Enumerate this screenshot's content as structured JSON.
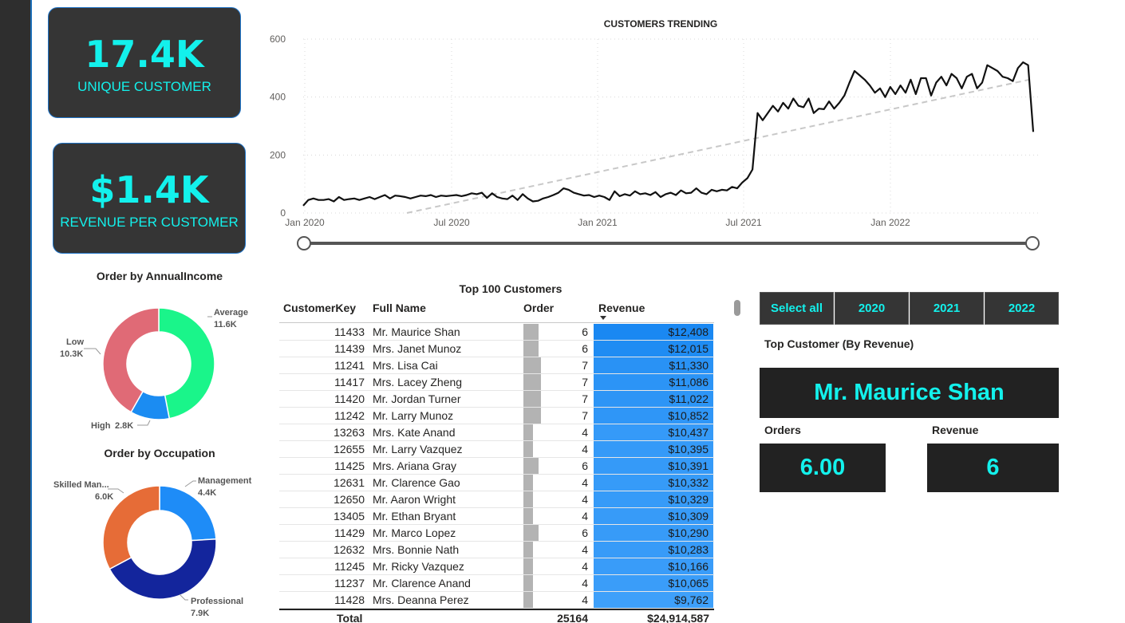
{
  "kpis": {
    "unique_customer": {
      "value": "17.4K",
      "label": "UNIQUE CUSTOMER"
    },
    "revenue_per_customer": {
      "value": "$1.4K",
      "label": "REVENUE PER CUSTOMER"
    }
  },
  "trend": {
    "title": "CUSTOMERS TRENDING",
    "y_ticks": [
      "600",
      "400",
      "200",
      "0"
    ],
    "x_ticks": [
      "Jan 2020",
      "Jul 2020",
      "Jan 2021",
      "Jul 2021",
      "Jan 2022"
    ]
  },
  "annual_income": {
    "title": "Order by AnnualIncome",
    "segments": [
      {
        "name": "Average",
        "value": "11.6K",
        "color": "#1af58a"
      },
      {
        "name": "High",
        "value": "2.8K",
        "color": "#1b8cf2"
      },
      {
        "name": "Low",
        "value": "10.3K",
        "color": "#e06a76"
      }
    ]
  },
  "occupation": {
    "title": "Order by Occupation",
    "segments": [
      {
        "name": "Management",
        "value": "4.4K",
        "color": "#1e8cf7"
      },
      {
        "name": "Professional",
        "value": "7.9K",
        "color": "#13259c"
      },
      {
        "name": "Skilled Man...",
        "value": "6.0K",
        "color": "#e66c37"
      }
    ]
  },
  "table": {
    "title": "Top 100 Customers",
    "columns": [
      "CustomerKey",
      "Full Name",
      "Order",
      "Revenue"
    ],
    "rows": [
      {
        "key": "11433",
        "name": "Mr. Maurice Shan",
        "order": "6",
        "revenue": "$12,408"
      },
      {
        "key": "11439",
        "name": "Mrs. Janet Munoz",
        "order": "6",
        "revenue": "$12,015"
      },
      {
        "key": "11241",
        "name": "Mrs. Lisa Cai",
        "order": "7",
        "revenue": "$11,330"
      },
      {
        "key": "11417",
        "name": "Mrs. Lacey Zheng",
        "order": "7",
        "revenue": "$11,086"
      },
      {
        "key": "11420",
        "name": "Mr. Jordan Turner",
        "order": "7",
        "revenue": "$11,022"
      },
      {
        "key": "11242",
        "name": "Mr. Larry Munoz",
        "order": "7",
        "revenue": "$10,852"
      },
      {
        "key": "13263",
        "name": "Mrs. Kate Anand",
        "order": "4",
        "revenue": "$10,437"
      },
      {
        "key": "12655",
        "name": "Mr. Larry Vazquez",
        "order": "4",
        "revenue": "$10,395"
      },
      {
        "key": "11425",
        "name": "Mrs. Ariana Gray",
        "order": "6",
        "revenue": "$10,391"
      },
      {
        "key": "12631",
        "name": "Mr. Clarence Gao",
        "order": "4",
        "revenue": "$10,332"
      },
      {
        "key": "12650",
        "name": "Mr. Aaron Wright",
        "order": "4",
        "revenue": "$10,329"
      },
      {
        "key": "13405",
        "name": "Mr. Ethan Bryant",
        "order": "4",
        "revenue": "$10,309"
      },
      {
        "key": "11429",
        "name": "Mr. Marco Lopez",
        "order": "6",
        "revenue": "$10,290"
      },
      {
        "key": "12632",
        "name": "Mrs. Bonnie Nath",
        "order": "4",
        "revenue": "$10,283"
      },
      {
        "key": "11245",
        "name": "Mr. Ricky Vazquez",
        "order": "4",
        "revenue": "$10,166"
      },
      {
        "key": "11237",
        "name": "Mr. Clarence Anand",
        "order": "4",
        "revenue": "$10,065"
      },
      {
        "key": "11428",
        "name": "Mrs. Deanna Perez",
        "order": "4",
        "revenue": "$9,762"
      }
    ],
    "total": {
      "label": "Total",
      "order": "25164",
      "revenue": "$24,914,587"
    }
  },
  "slicer": {
    "options": [
      "Select all",
      "2020",
      "2021",
      "2022"
    ]
  },
  "top_customer": {
    "title": "Top Customer (By Revenue)",
    "name": "Mr. Maurice Shan",
    "orders_label": "Orders",
    "orders_value": "6.00",
    "revenue_label": "Revenue",
    "revenue_value": "6"
  },
  "chart_data": {
    "type": "line",
    "title": "CUSTOMERS TRENDING",
    "xlabel": "",
    "ylabel": "",
    "ylim": [
      0,
      600
    ],
    "x_range": [
      "2020-01",
      "2022-06"
    ],
    "x_ticks": [
      "Jan 2020",
      "Jul 2020",
      "Jan 2021",
      "Jul 2021",
      "Jan 2022"
    ],
    "grid": true,
    "series": [
      {
        "values": [
          25,
          45,
          50,
          45,
          45,
          48,
          40,
          55,
          45,
          48,
          50,
          45,
          50,
          55,
          48,
          55,
          62,
          50,
          60,
          58,
          55,
          50,
          55,
          60,
          58,
          62,
          55,
          60,
          58,
          60,
          62,
          58,
          62,
          68,
          65,
          70,
          52,
          68,
          55,
          50,
          48,
          60,
          45,
          65,
          50,
          40,
          42,
          50,
          55,
          62,
          70,
          85,
          80,
          70,
          65,
          60,
          62,
          55,
          60,
          55,
          45,
          75,
          58,
          65,
          60,
          75,
          65,
          68,
          62,
          72,
          55,
          65,
          70,
          62,
          78,
          68,
          70,
          85,
          70,
          65,
          80,
          75,
          80,
          78,
          90,
          85,
          105,
          120,
          150,
          345,
          320,
          345,
          370,
          350,
          380,
          360,
          395,
          370,
          365,
          395,
          345,
          360,
          358,
          385,
          360,
          380,
          405,
          450,
          490,
          475,
          460,
          440,
          415,
          430,
          400,
          435,
          410,
          440,
          415,
          460,
          410,
          465,
          465,
          405,
          450,
          470,
          440,
          480,
          465,
          430,
          470,
          480,
          430,
          450,
          510,
          500,
          490,
          470,
          465,
          455,
          500,
          520,
          510,
          280
        ]
      },
      {
        "values": [
          0,
          460
        ],
        "style": "dashed-trend"
      }
    ]
  }
}
